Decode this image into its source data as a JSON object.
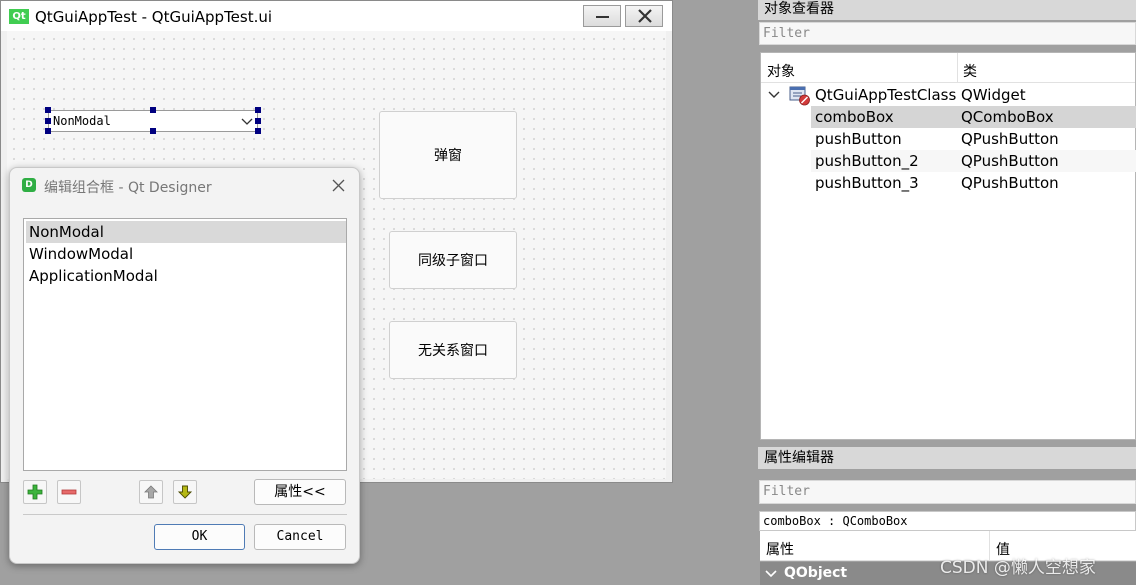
{
  "form_window": {
    "logo_text": "Qt",
    "title": "QtGuiAppTest - QtGuiAppTest.ui"
  },
  "form": {
    "combo_value": "NonModal",
    "button1_label": "弹窗",
    "button2_label": "同级子窗口",
    "button3_label": "无关系窗口"
  },
  "dialog": {
    "logo_text": "D",
    "title": "编辑组合框 - Qt Designer",
    "items": [
      "NonModal",
      "WindowModal",
      "ApplicationModal"
    ],
    "selected_item": "NonModal",
    "properties_label": "属性<<",
    "ok_label": "OK",
    "cancel_label": "Cancel"
  },
  "object_inspector": {
    "title": "对象查看器",
    "filter_placeholder": "Filter",
    "col_object": "对象",
    "col_class": "类",
    "root": {
      "name": "QtGuiAppTestClass",
      "class": "QWidget"
    },
    "children": [
      {
        "name": "comboBox",
        "class": "QComboBox"
      },
      {
        "name": "pushButton",
        "class": "QPushButton"
      },
      {
        "name": "pushButton_2",
        "class": "QPushButton"
      },
      {
        "name": "pushButton_3",
        "class": "QPushButton"
      }
    ],
    "selected_child": "comboBox"
  },
  "property_editor": {
    "title": "属性编辑器",
    "filter_placeholder": "Filter",
    "object_label": "comboBox : QComboBox",
    "col_property": "属性",
    "col_value": "值",
    "group": "QObject"
  },
  "watermark": "CSDN @懒人空想家",
  "colors": {
    "handle": "#000080",
    "qt_green": "#41cd52",
    "selection": "#d5d5d5",
    "group_bg": "#8a8a8a"
  },
  "icons": [
    "qt-logo-icon",
    "minimize-icon",
    "close-icon",
    "chevron-down-icon",
    "designer-logo-icon",
    "add-icon",
    "remove-icon",
    "arrow-up-icon",
    "arrow-down-icon",
    "widget-icon"
  ]
}
